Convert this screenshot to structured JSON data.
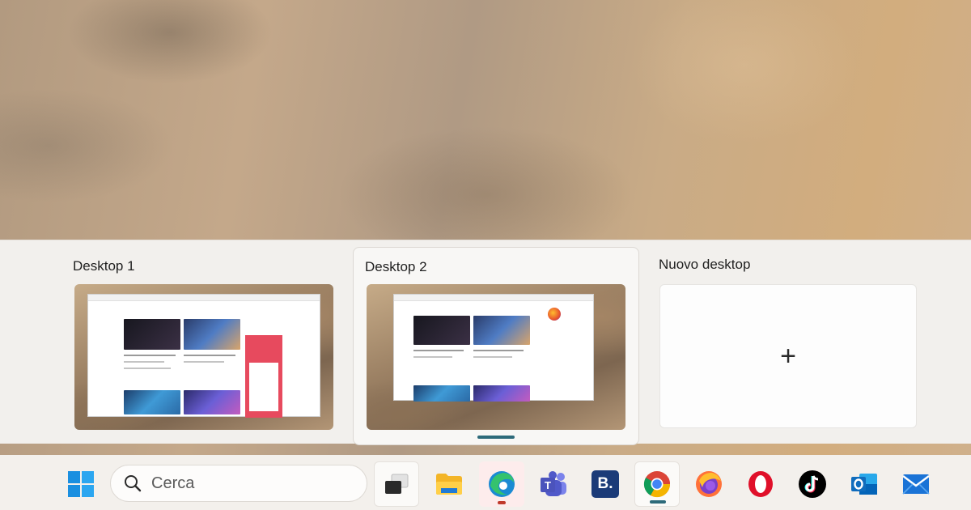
{
  "task_view": {
    "desktops": [
      {
        "name": "Desktop 1",
        "active": false
      },
      {
        "name": "Desktop 2",
        "active": true
      }
    ],
    "new_desktop_label": "Nuovo desktop",
    "new_desktop_icon": "plus-icon",
    "new_desktop_glyph": "+"
  },
  "taskbar": {
    "search_placeholder": "Cerca",
    "apps": [
      {
        "name": "start-button",
        "icon": "windows-logo-icon"
      },
      {
        "name": "task-view-button",
        "icon": "task-view-icon"
      },
      {
        "name": "file-explorer",
        "icon": "folder-icon"
      },
      {
        "name": "edge",
        "icon": "edge-icon",
        "running": true,
        "indicator_color": "#c0392b"
      },
      {
        "name": "teams",
        "icon": "teams-icon"
      },
      {
        "name": "booking",
        "icon": "booking-icon"
      },
      {
        "name": "chrome",
        "icon": "chrome-icon",
        "running": true,
        "indicator_color": "#2d6a7a"
      },
      {
        "name": "firefox",
        "icon": "firefox-icon"
      },
      {
        "name": "opera",
        "icon": "opera-icon"
      },
      {
        "name": "tiktok",
        "icon": "tiktok-icon"
      },
      {
        "name": "outlook",
        "icon": "outlook-icon"
      },
      {
        "name": "mail",
        "icon": "mail-icon"
      }
    ],
    "booking_letter": "B."
  },
  "colors": {
    "accent": "#2d6a7a",
    "edge_indicator": "#c0392b"
  }
}
